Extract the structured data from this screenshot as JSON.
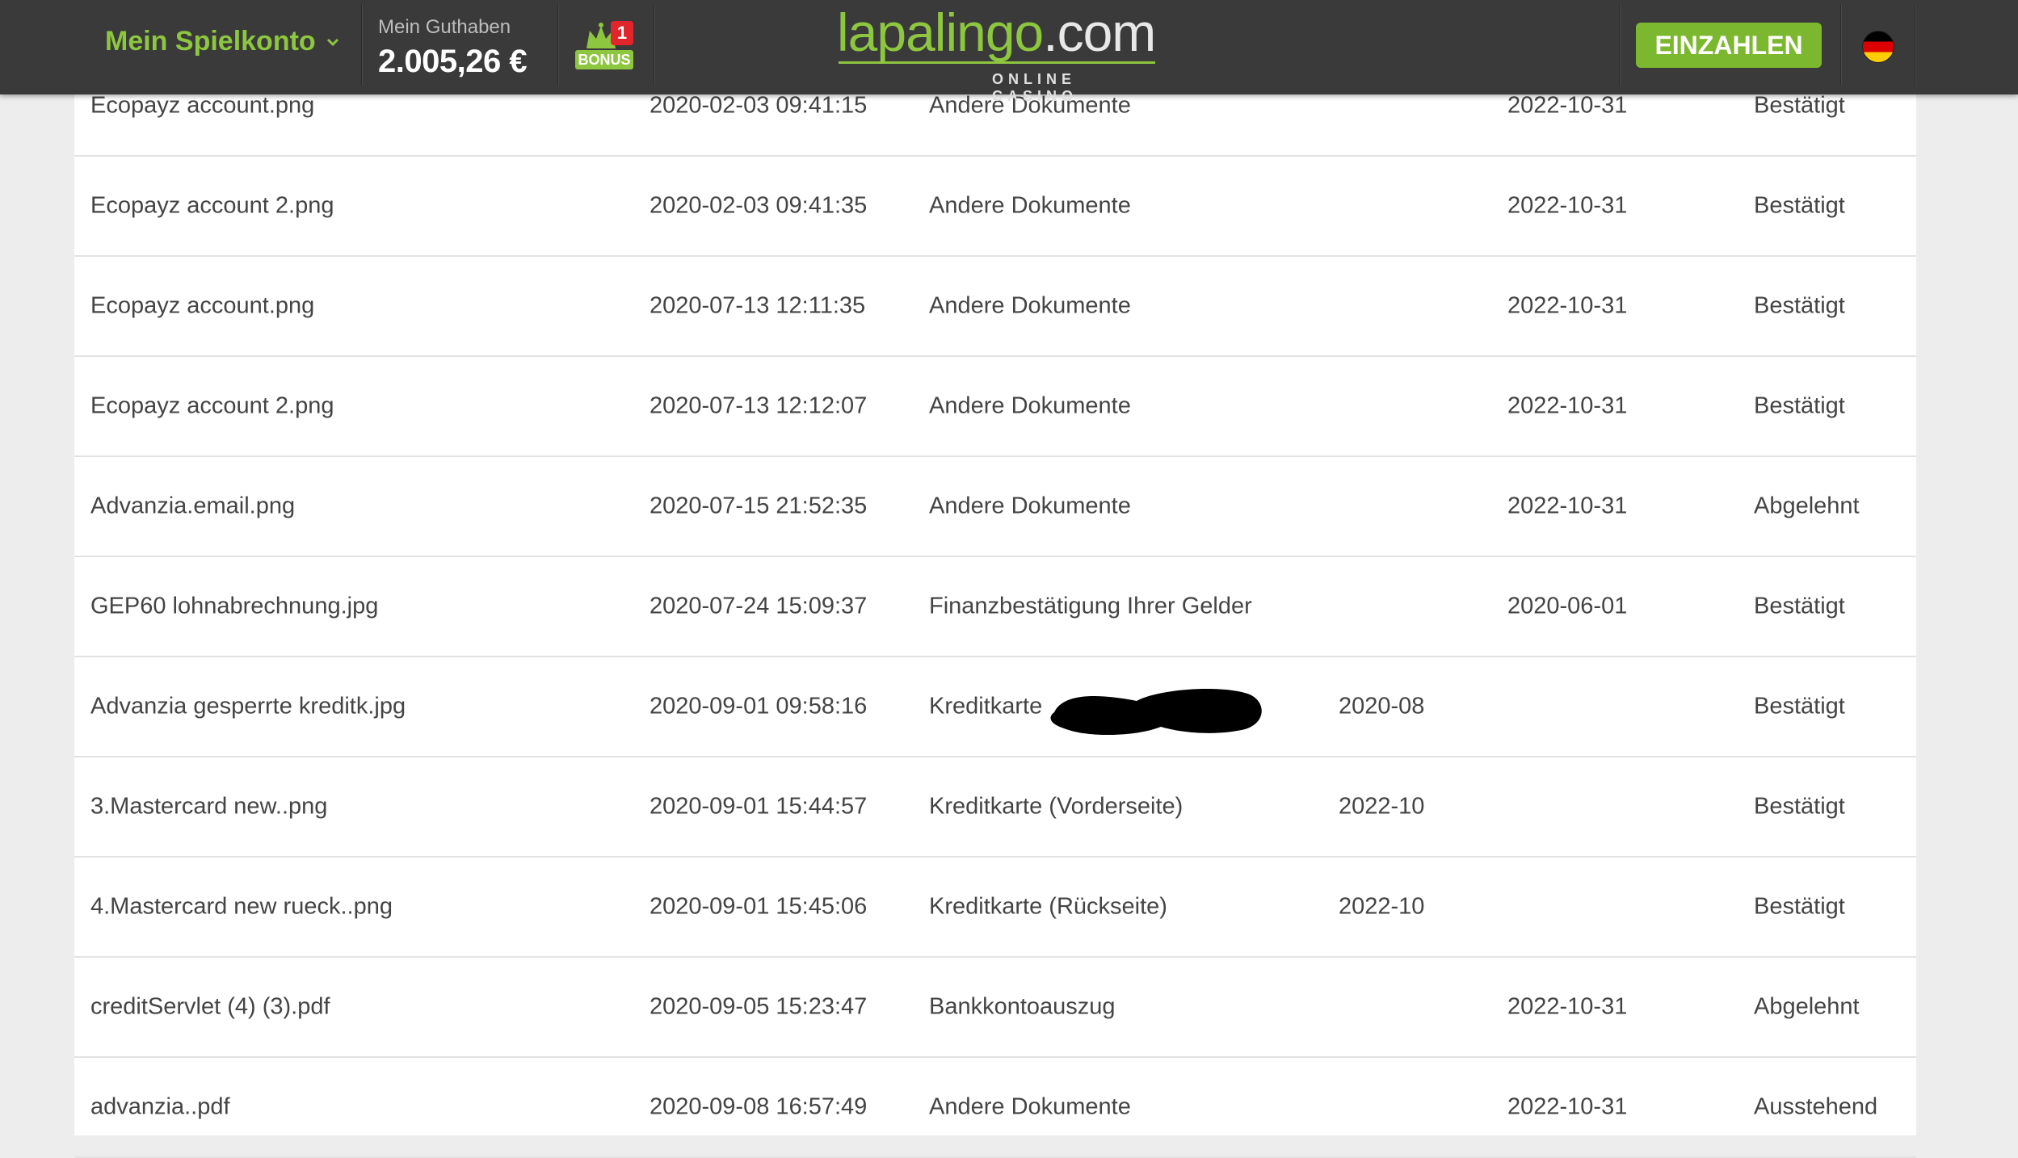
{
  "header": {
    "account_menu_label": "Mein Spielkonto",
    "balance_label": "Mein Guthaben",
    "balance_value": "2.005,26 €",
    "bonus_badge": "1",
    "bonus_label": "BONUS",
    "logo_main": "lapalingo",
    "logo_tld": ".com",
    "logo_sub": "ONLINE CASINO",
    "deposit_label": "EINZAHLEN",
    "language_flag": "de-flag-icon"
  },
  "colors": {
    "header_bg": "#3a3a3a",
    "accent_green": "#8dc63f",
    "button_green": "#7cb82f",
    "page_bg": "#ededed"
  },
  "documents": [
    {
      "name": "Ecopayz account.png",
      "uploaded": "2020-02-03 09:41:15",
      "type": "Andere Dokumente",
      "expiry": "",
      "valid_until": "2022-10-31",
      "status": "Bestätigt"
    },
    {
      "name": "Ecopayz account 2.png",
      "uploaded": "2020-02-03 09:41:35",
      "type": "Andere Dokumente",
      "expiry": "",
      "valid_until": "2022-10-31",
      "status": "Bestätigt"
    },
    {
      "name": "Ecopayz account.png",
      "uploaded": "2020-07-13 12:11:35",
      "type": "Andere Dokumente",
      "expiry": "",
      "valid_until": "2022-10-31",
      "status": "Bestätigt"
    },
    {
      "name": "Ecopayz account 2.png",
      "uploaded": "2020-07-13 12:12:07",
      "type": "Andere Dokumente",
      "expiry": "",
      "valid_until": "2022-10-31",
      "status": "Bestätigt"
    },
    {
      "name": "Advanzia.email.png",
      "uploaded": "2020-07-15 21:52:35",
      "type": "Andere Dokumente",
      "expiry": "",
      "valid_until": "2022-10-31",
      "status": "Abgelehnt"
    },
    {
      "name": "GEP60 lohnabrechnung.jpg",
      "uploaded": "2020-07-24 15:09:37",
      "type": "Finanzbestätigung Ihrer Gelder",
      "expiry": "",
      "valid_until": "2020-06-01",
      "status": "Bestätigt"
    },
    {
      "name": "Advanzia gesperrte kreditk.jpg",
      "uploaded": "2020-09-01 09:58:16",
      "type": "Kreditkarte",
      "expiry": "2020-08",
      "valid_until": "",
      "status": "Bestätigt"
    },
    {
      "name": "3.Mastercard new..png",
      "uploaded": "2020-09-01 15:44:57",
      "type": "Kreditkarte (Vorderseite)",
      "expiry": "2022-10",
      "valid_until": "",
      "status": "Bestätigt"
    },
    {
      "name": "4.Mastercard new rueck..png",
      "uploaded": "2020-09-01 15:45:06",
      "type": "Kreditkarte (Rückseite)",
      "expiry": "2022-10",
      "valid_until": "",
      "status": "Bestätigt"
    },
    {
      "name": "creditServlet (4) (3).pdf",
      "uploaded": "2020-09-05 15:23:47",
      "type": "Bankkontoauszug",
      "expiry": "",
      "valid_until": "2022-10-31",
      "status": "Abgelehnt"
    },
    {
      "name": "advanzia..pdf",
      "uploaded": "2020-09-08 16:57:49",
      "type": "Andere Dokumente",
      "expiry": "",
      "valid_until": "2022-10-31",
      "status": "Ausstehend"
    }
  ]
}
